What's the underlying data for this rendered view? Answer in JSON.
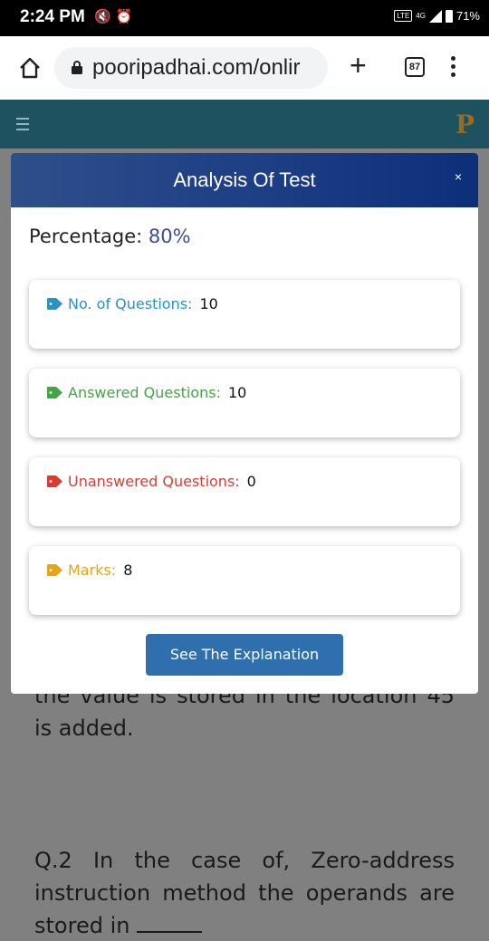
{
  "status_bar": {
    "time": "2:24 PM",
    "network": "4G",
    "battery": "71%"
  },
  "browser": {
    "url": "pooripadhai.com/onlir",
    "tab_count": "87",
    "new_tab_label": "+"
  },
  "site_header": {
    "logo_text": "P"
  },
  "background_text": {
    "fragment": "the value is stored in the location 45 is added.",
    "question": "Q.2 In the case of, Zero-address instruction method the operands are stored in"
  },
  "modal": {
    "title": "Analysis Of Test",
    "close_label": "×",
    "percentage_label": "Percentage:",
    "percentage_value": "80%",
    "cards": [
      {
        "label": "No. of Questions:",
        "value": "10",
        "color": "#2a92c7"
      },
      {
        "label": "Answered Questions:",
        "value": "10",
        "color": "#42a645"
      },
      {
        "label": "Unanswered Questions:",
        "value": "0",
        "color": "#dc3b33"
      },
      {
        "label": "Marks:",
        "value": "8",
        "color": "#e8a317"
      }
    ],
    "explanation_button": "See The Explanation"
  },
  "colors": {
    "modal_header": "#1f3f86",
    "button": "#2f6fae",
    "site_header": "#1f5260"
  }
}
